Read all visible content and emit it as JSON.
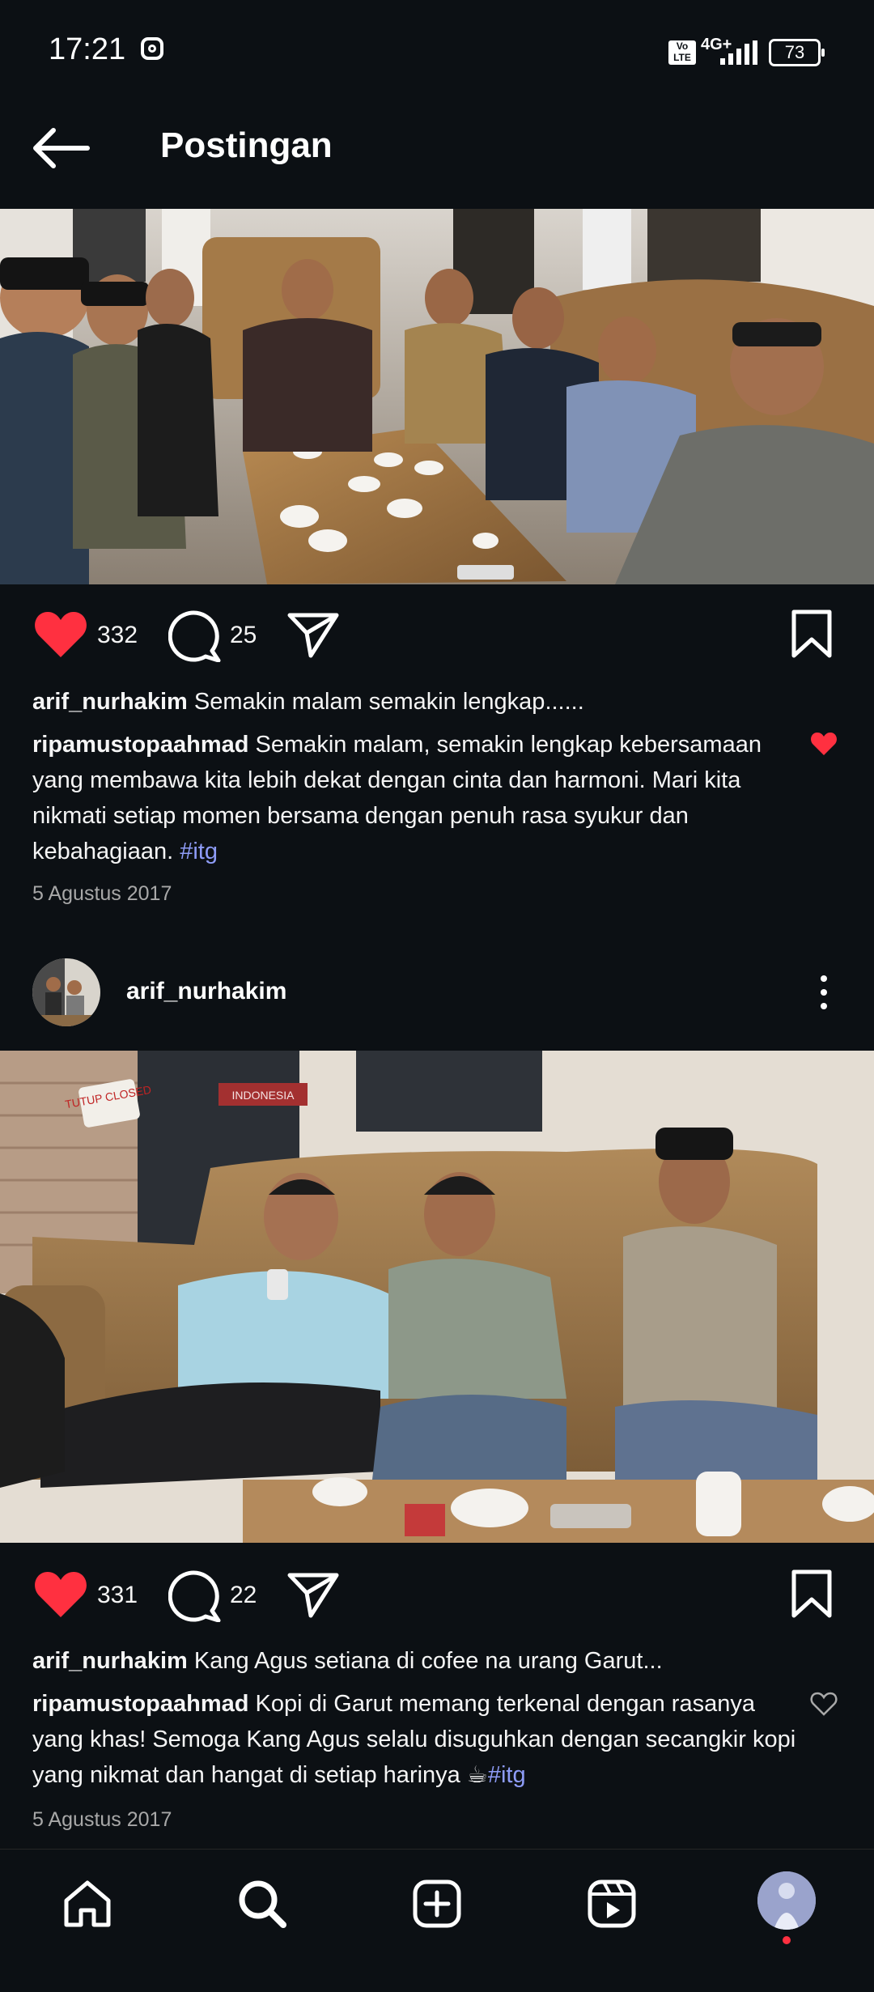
{
  "status_bar": {
    "time": "17:21",
    "volte": "Vo LTE",
    "network": "4G+",
    "battery": "73"
  },
  "header": {
    "title": "Postingan"
  },
  "post1": {
    "likes": "332",
    "comments": "25",
    "caption_user": "arif_nurhakim",
    "caption_text": " Semakin malam semakin lengkap......",
    "comment_user": "ripamustopaahmad",
    "comment_text": " Semakin malam, semakin lengkap kebersamaan yang membawa kita lebih dekat dengan cinta dan harmoni. Mari kita nikmati setiap momen bersama dengan penuh rasa syukur dan kebahagiaan. ",
    "comment_tag": "#itg",
    "comment_liked": true,
    "date": "5 Agustus 2017"
  },
  "post2": {
    "username": "arif_nurhakim",
    "photo_sign_1": "TUTUP CLOSED",
    "photo_sign_2": "INDONESIA",
    "likes": "331",
    "comments": "22",
    "caption_user": "arif_nurhakim",
    "caption_text": " Kang Agus setiana di cofee na urang Garut...",
    "comment_user": "ripamustopaahmad",
    "comment_text": " Kopi di Garut memang terkenal dengan rasanya yang khas! Semoga Kang Agus selalu disuguhkan dengan secangkir kopi yang nikmat dan hangat di setiap harinya ☕",
    "comment_tag": "#itg",
    "comment_liked": false,
    "date": "5 Agustus 2017"
  },
  "nav": {
    "items": [
      "home-icon",
      "search-icon",
      "create-icon",
      "reels-icon",
      "profile-avatar"
    ]
  },
  "colors": {
    "background": "#0c1014",
    "like_red": "#ff3040",
    "hashtag": "#8e9cf7"
  }
}
